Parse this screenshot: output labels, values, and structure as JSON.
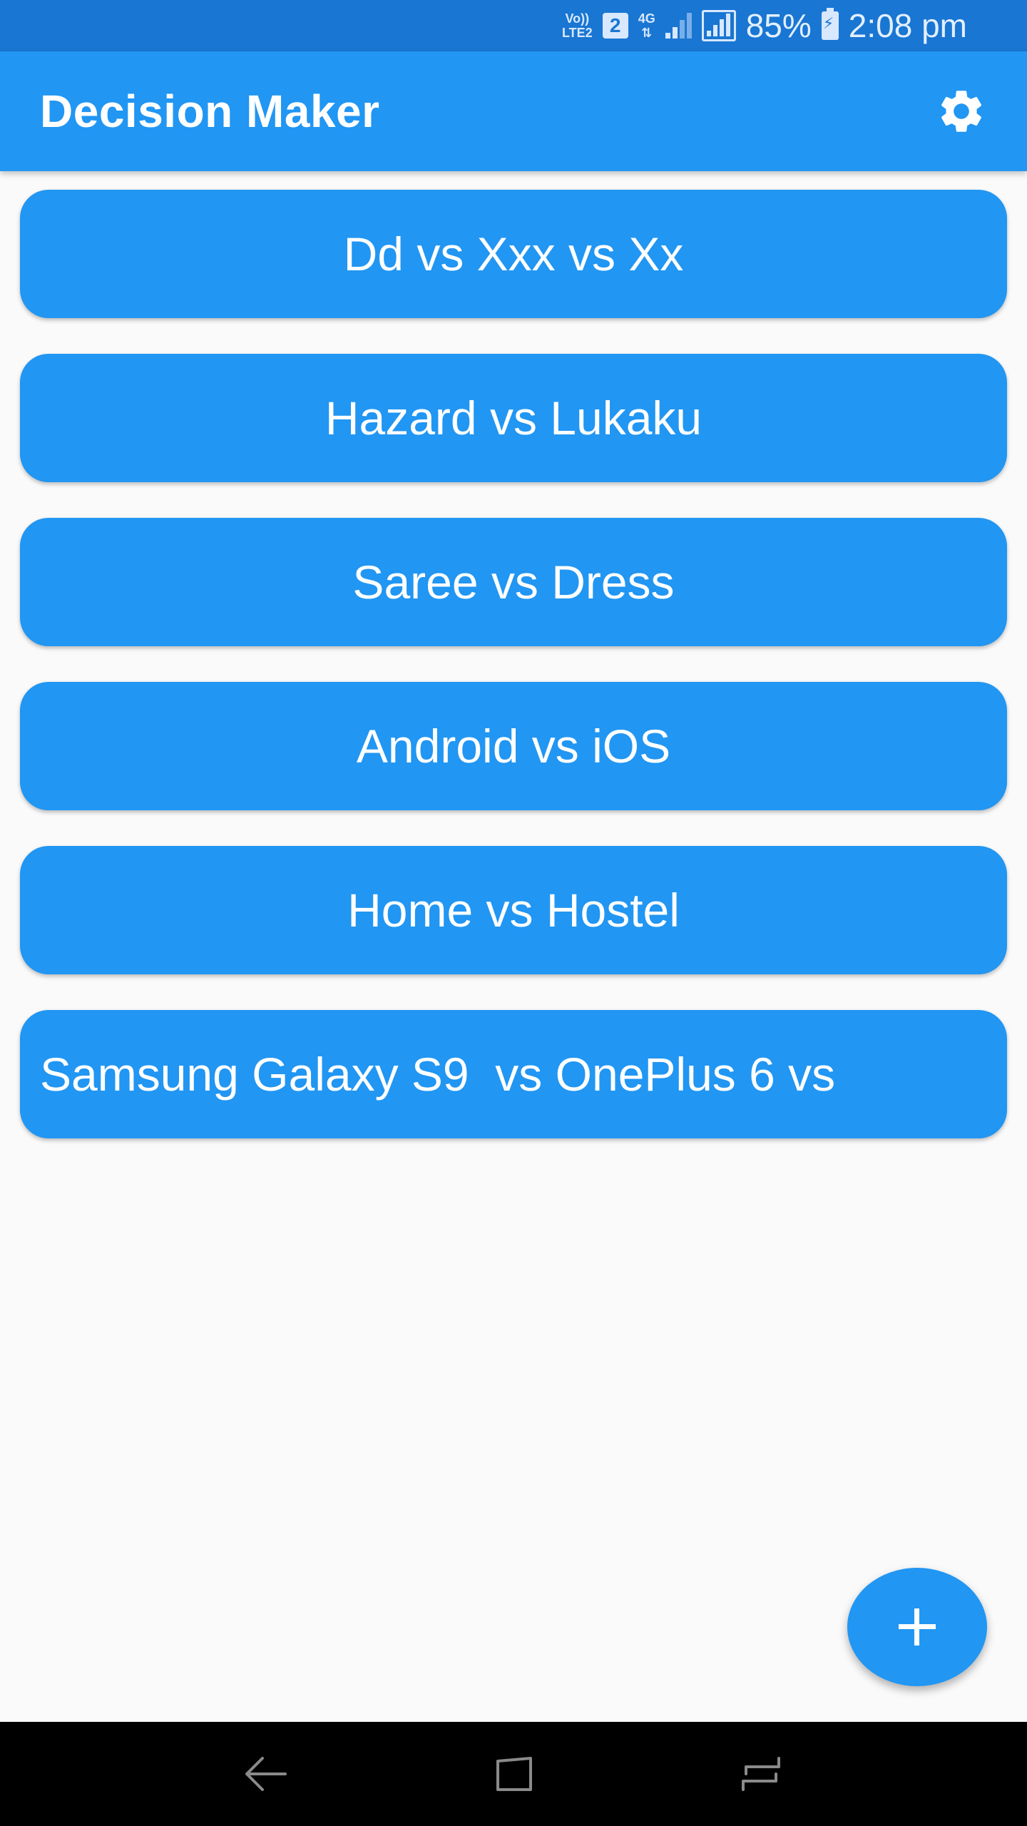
{
  "status_bar": {
    "volte_top": "Vo))",
    "volte_bottom": "LTE2",
    "sim_number": "2",
    "network": "4G",
    "battery": "85%",
    "time": "2:08 pm"
  },
  "app_bar": {
    "title": "Decision Maker",
    "settings_icon": "gear-icon",
    "color": "#2196f3"
  },
  "decisions": [
    {
      "label": "Dd vs Xxx vs Xx"
    },
    {
      "label": "Hazard vs Lukaku"
    },
    {
      "label": "Saree vs Dress"
    },
    {
      "label": "Android vs iOS"
    },
    {
      "label": "Home vs Hostel"
    },
    {
      "label": "Samsung Galaxy S9  vs OnePlus 6 vs"
    }
  ],
  "fab": {
    "icon": "plus-icon"
  },
  "nav_bar": {
    "back_icon": "back-icon",
    "home_icon": "home-icon",
    "recents_icon": "recents-icon"
  }
}
